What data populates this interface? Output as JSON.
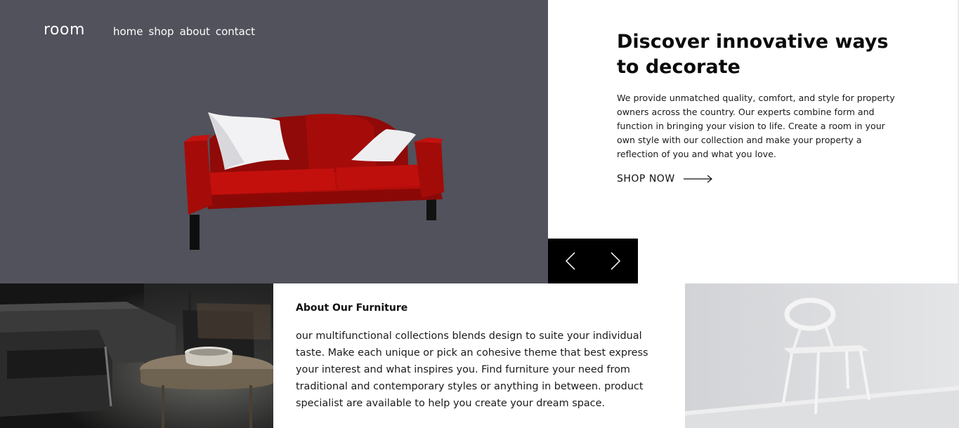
{
  "brand": {
    "logo": "room"
  },
  "nav": {
    "items": [
      "home",
      "shop",
      "about",
      "contact"
    ]
  },
  "hero": {
    "title": "Discover innovative ways to decorate",
    "description": "We provide unmatched quality, comfort, and style for property owners across the country. Our experts combine form and function in bringing your vision to life. Create a room in your own style with our collection and make your property a reflection of you and what you love.",
    "cta_label": "SHOP NOW",
    "cta_icon": "arrow-right-icon"
  },
  "slider": {
    "prev_icon": "chevron-left-icon",
    "next_icon": "chevron-right-icon"
  },
  "about": {
    "title": "About Our Furniture",
    "text": "our multifunctional collections blends design to suite your individual taste. Make each unique or pick an cohesive theme that best express your interest and what inspires you. Find furniture your need from traditional and contemporary styles or anything in between. product specialist are available to help you create your dream space."
  },
  "colors": {
    "hero_bg": "#51525c",
    "sofa": "#b40d0a",
    "controls_bg": "#000000"
  }
}
